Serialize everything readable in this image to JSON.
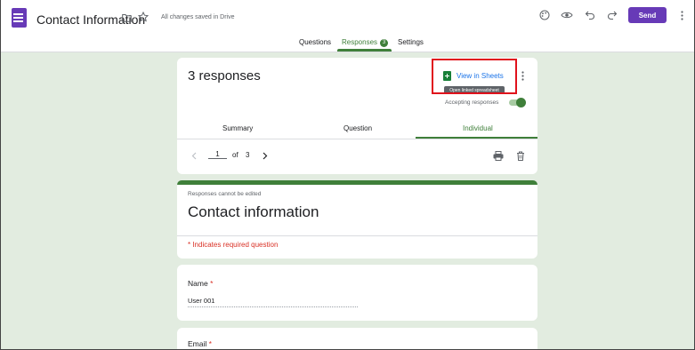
{
  "header": {
    "title": "Contact Information",
    "saved_status": "All changes saved in Drive",
    "send_label": "Send"
  },
  "tabs": [
    {
      "label": "Questions",
      "active": false
    },
    {
      "label": "Responses",
      "active": true,
      "badge": "3"
    },
    {
      "label": "Settings",
      "active": false
    }
  ],
  "responses": {
    "title": "3 responses",
    "view_in_sheets": "View in Sheets",
    "tooltip": "Open linked spreadsheet",
    "accepting_label": "Accepting responses",
    "accepting": true,
    "subtabs": [
      {
        "label": "Summary",
        "active": false
      },
      {
        "label": "Question",
        "active": false
      },
      {
        "label": "Individual",
        "active": true
      }
    ],
    "pager": {
      "current": "1",
      "of_label": "of",
      "total": "3"
    }
  },
  "form": {
    "notice": "Responses cannot be edited",
    "title": "Contact information",
    "required_note": "* Indicates required question"
  },
  "questions": [
    {
      "label": "Name",
      "required_mark": "*",
      "answer": "User 001"
    },
    {
      "label": "Email",
      "required_mark": "*"
    }
  ],
  "colors": {
    "brand_purple": "#673ab7",
    "accent_green": "#3f7f3a",
    "highlight_red": "#e0121c",
    "link_blue": "#1a73e8"
  }
}
